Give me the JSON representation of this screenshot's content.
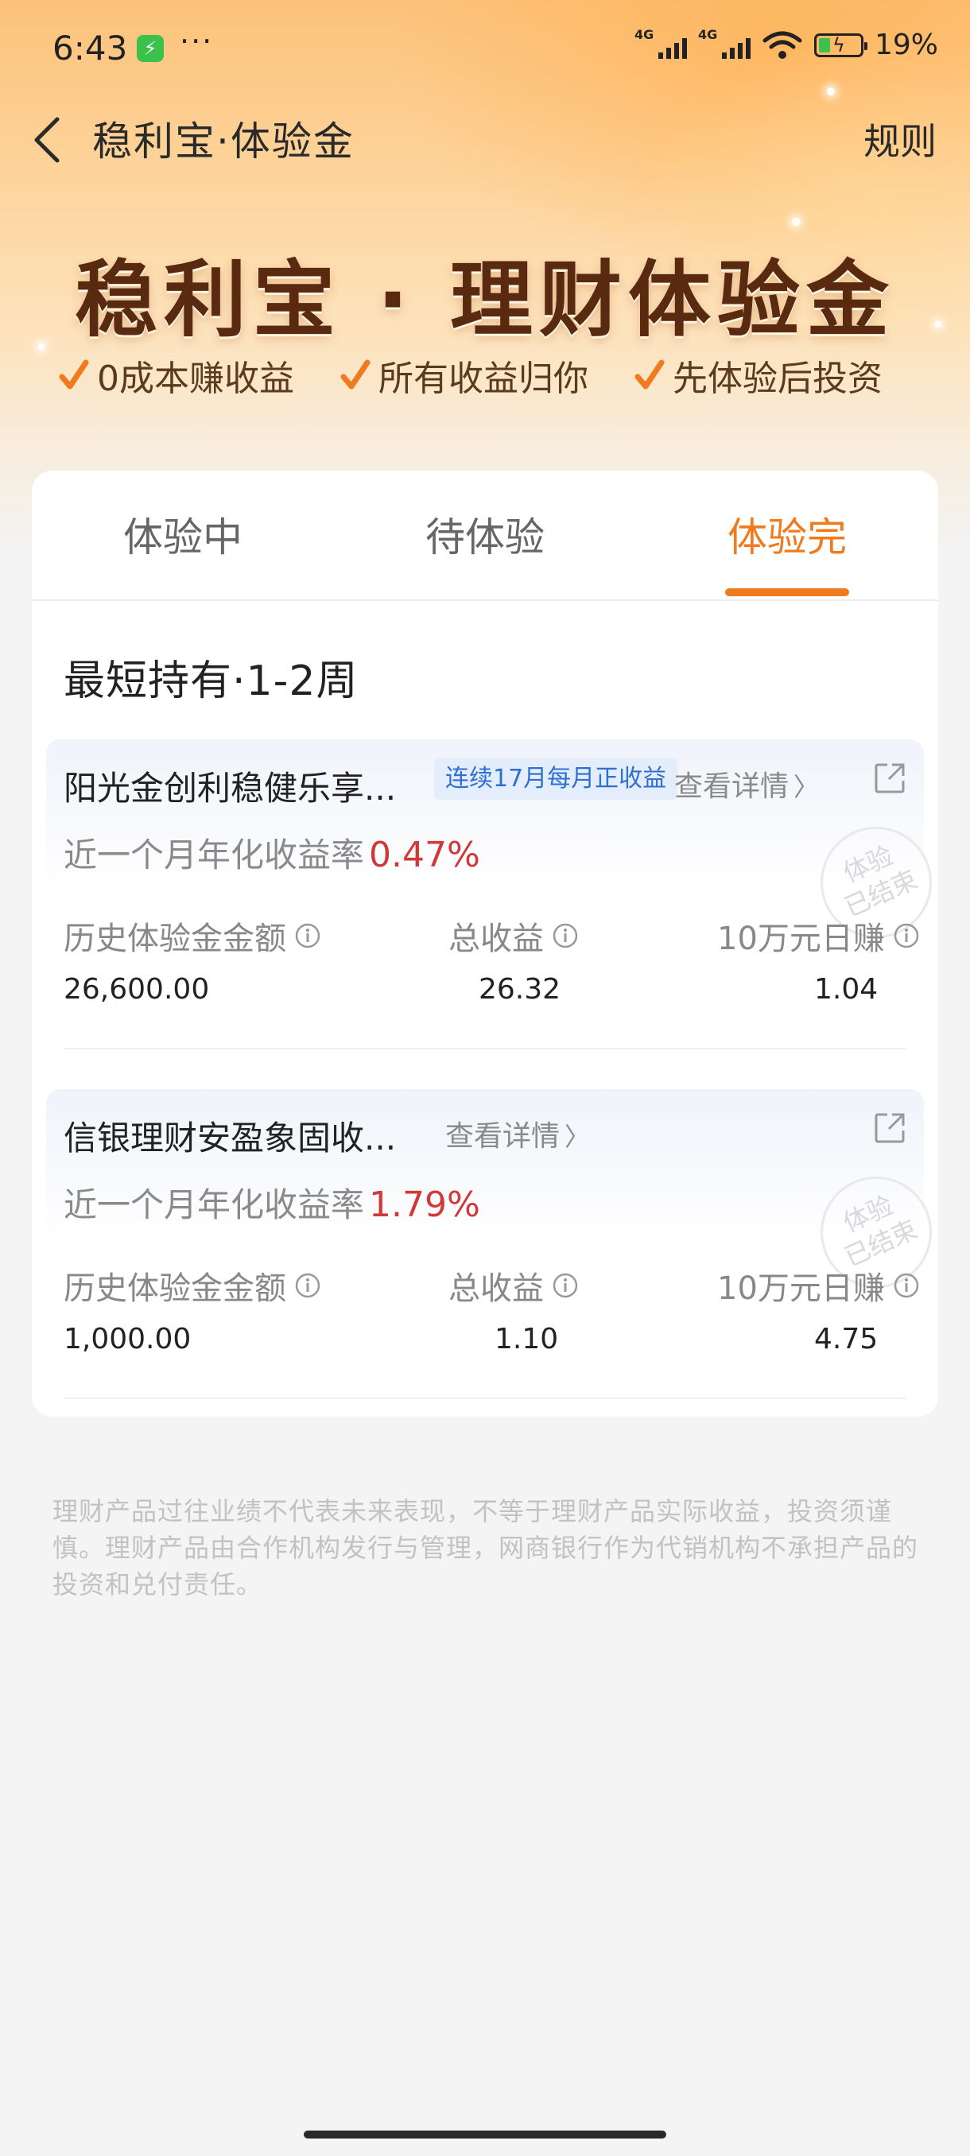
{
  "status_bar": {
    "time": "6:43",
    "more": "···",
    "signal1_label": "4G",
    "signal2_label": "4G",
    "battery_percent": "19%"
  },
  "nav": {
    "title": "稳利宝·体验金",
    "rules": "规则"
  },
  "hero": {
    "title": "稳利宝 · 理财体验金",
    "features": [
      "0成本赚收益",
      "所有收益归你",
      "先体验后投资"
    ]
  },
  "tabs": [
    {
      "label": "体验中",
      "active": false
    },
    {
      "label": "待体验",
      "active": false
    },
    {
      "label": "体验完",
      "active": true
    }
  ],
  "section": {
    "title": "最短持有·1-2周"
  },
  "products": [
    {
      "name": "阳光金创利稳健乐享...",
      "tag": "连续17月每月正收益",
      "detail": "查看详情",
      "rate_label": "近一个月年化收益率",
      "rate_value": "0.47%",
      "stamp": "体验已结束",
      "stamp_line1": "体验",
      "stamp_line2": "已结束",
      "stats": [
        {
          "label": "历史体验金金额",
          "value": "26,600.00"
        },
        {
          "label": "总收益",
          "value": "26.32"
        },
        {
          "label": "10万元日赚",
          "value": "1.04"
        }
      ]
    },
    {
      "name": "信银理财安盈象固收...",
      "tag": "",
      "detail": "查看详情",
      "rate_label": "近一个月年化收益率",
      "rate_value": "1.79%",
      "stamp": "体验已结束",
      "stamp_line1": "体验",
      "stamp_line2": "已结束",
      "stats": [
        {
          "label": "历史体验金金额",
          "value": "1,000.00"
        },
        {
          "label": "总收益",
          "value": "1.10"
        },
        {
          "label": "10万元日赚",
          "value": "4.75"
        }
      ]
    }
  ],
  "disclaimer": "理财产品过往业绩不代表未来表现，不等于理财产品实际收益，投资须谨慎。理财产品由合作机构发行与管理，网商银行作为代销机构不承担产品的投资和兑付责任。",
  "colors": {
    "accent": "#f07a1e",
    "rate_red": "#d23838",
    "tag_blue": "#2f6fd0"
  }
}
